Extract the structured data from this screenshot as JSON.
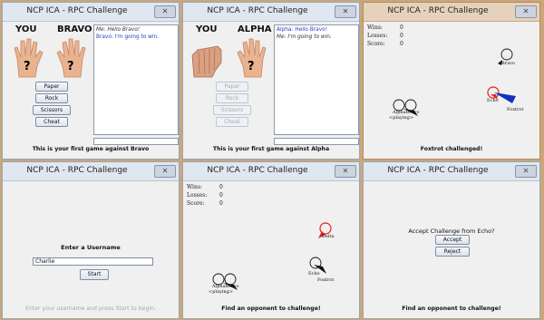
{
  "windows": {
    "title": "NCP ICA - RPC Challenge",
    "close_label": "✕"
  },
  "game1": {
    "you_label": "YOU",
    "opponent_label": "BRAVO",
    "chat": [
      {
        "kind": "me",
        "text": "Me: Hello Bravo!"
      },
      {
        "kind": "opp",
        "text": "Bravo: I'm going to win."
      }
    ],
    "buttons": [
      "Paper",
      "Rock",
      "Scissors",
      "Cheat"
    ],
    "status": "This is your first game against Bravo"
  },
  "game2": {
    "you_label": "YOU",
    "opponent_label": "ALPHA",
    "chat": [
      {
        "kind": "opp",
        "text": "Alpha: Hello Bravo!"
      },
      {
        "kind": "me",
        "text": "Me: I'm going to win."
      }
    ],
    "buttons": [
      "Paper",
      "Rock",
      "Scissors",
      "Cheat"
    ],
    "status": "This is your first game against Alpha"
  },
  "map1": {
    "stats": [
      {
        "label": "Wins:",
        "value": "0"
      },
      {
        "label": "Losses:",
        "value": "0"
      },
      {
        "label": "Score:",
        "value": "0"
      }
    ],
    "labels": {
      "bravo": "Bravo",
      "alpha_bravo": "AlphaBravo",
      "playing": "<playing>",
      "echo": "Echo",
      "foxtrot": "Foxtrot"
    },
    "status": "Foxtrot challenged!"
  },
  "login": {
    "prompt": "Enter a Username",
    "username": "Charlie",
    "start_label": "Start",
    "status": "Enter your username and press Start to begin."
  },
  "map2": {
    "stats": [
      {
        "label": "Wins:",
        "value": "0"
      },
      {
        "label": "Losses:",
        "value": "0"
      },
      {
        "label": "Score:",
        "value": "0"
      }
    ],
    "labels": {
      "delta": "Delta",
      "alpha_bravo": "AlphaBravo",
      "playing": "<playing>",
      "echo": "Echo",
      "foxtrot": "Foxtrot"
    },
    "status": "Find an opponent to challenge!"
  },
  "challenge": {
    "prompt": "Accept Challenge from Echo?",
    "accept_label": "Accept",
    "reject_label": "Reject",
    "status": "Find an opponent to challenge!"
  },
  "colors": {
    "desktop": "#c9a77c",
    "titlebar": "#dfe7f1",
    "active_titlebar": "#e6d2bb",
    "self_chat": "#333333",
    "opponent_chat": "#1f3fbf",
    "red_player": "#e02020",
    "blue_player": "#1030c0"
  }
}
